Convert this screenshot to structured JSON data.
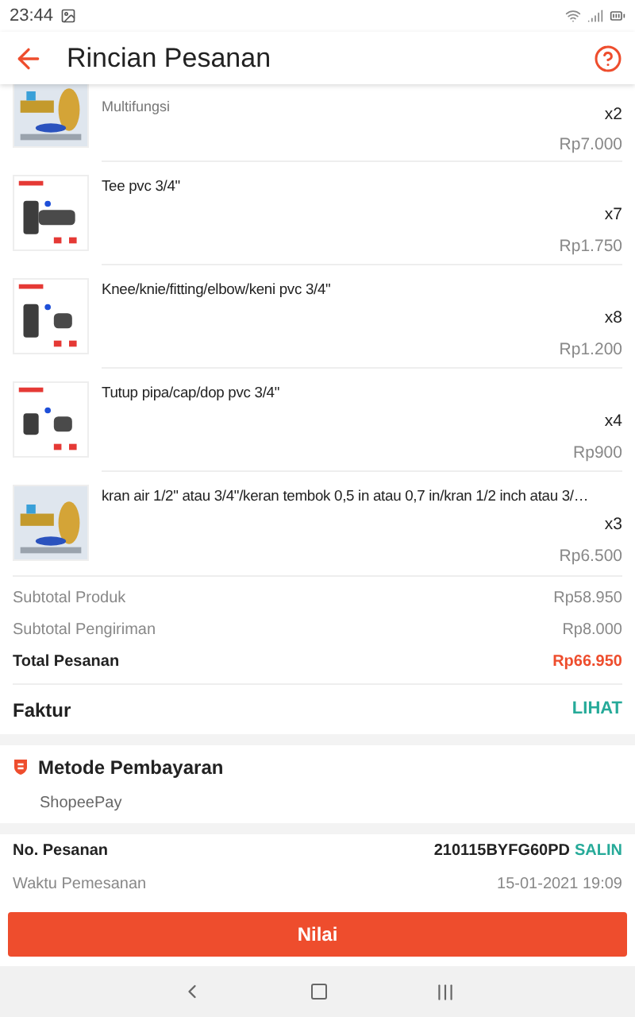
{
  "status_bar": {
    "time": "23:44"
  },
  "header": {
    "title": "Rincian Pesanan"
  },
  "items": [
    {
      "variation": "Multifungsi",
      "qty": "x2",
      "price": "Rp7.000",
      "partial": true
    },
    {
      "name": "Tee pvc 3/4\"",
      "qty": "x7",
      "price": "Rp1.750"
    },
    {
      "name": "Knee/knie/fitting/elbow/keni pvc 3/4\"",
      "qty": "x8",
      "price": "Rp1.200"
    },
    {
      "name": "Tutup pipa/cap/dop pvc 3/4\"",
      "qty": "x4",
      "price": "Rp900"
    },
    {
      "name": "kran air 1/2\" atau 3/4\"/keran tembok 0,5 in atau 0,7 in/kran 1/2 inch atau 3/…",
      "qty": "x3",
      "price": "Rp6.500"
    }
  ],
  "summary": [
    {
      "label": "Subtotal Produk",
      "value": "Rp58.950",
      "kind": "normal"
    },
    {
      "label": "Subtotal Pengiriman",
      "value": "Rp8.000",
      "kind": "normal"
    },
    {
      "label": "Total Pesanan",
      "value": "Rp66.950",
      "kind": "total"
    }
  ],
  "invoice": {
    "label": "Faktur",
    "action": "LIHAT"
  },
  "payment": {
    "title": "Metode Pembayaran",
    "method": "ShopeePay"
  },
  "order": {
    "number_label": "No. Pesanan",
    "number": "210115BYFG60PD",
    "copy": "SALIN",
    "time_label": "Waktu Pemesanan",
    "time": "15-01-2021 19:09"
  },
  "button": "Nilai"
}
